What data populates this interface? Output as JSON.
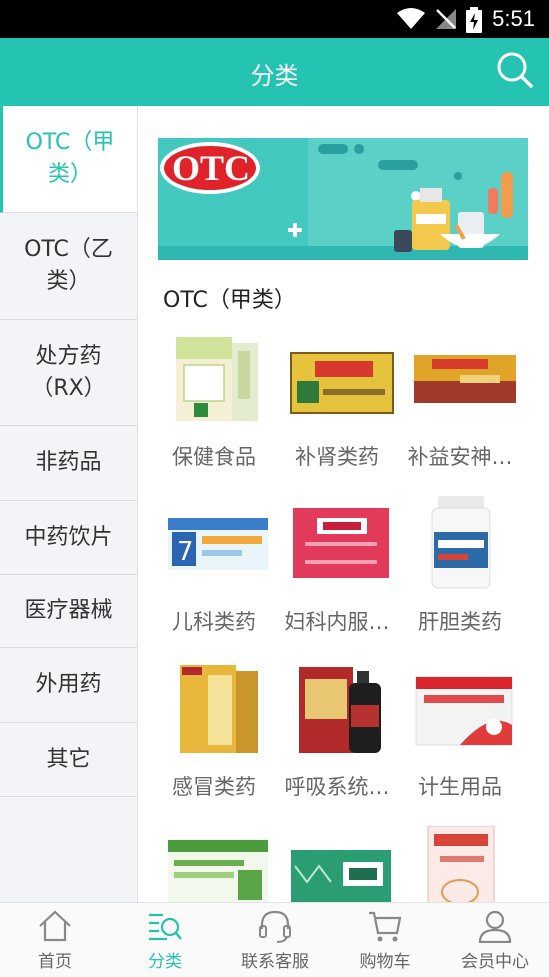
{
  "status_bar": {
    "time": "5:51"
  },
  "header": {
    "title": "分类"
  },
  "sidebar": {
    "items": [
      {
        "label": "OTC（甲类）",
        "active": true
      },
      {
        "label": "OTC（乙类）",
        "active": false
      },
      {
        "label": "处方药（RX）",
        "active": false
      },
      {
        "label": "非药品",
        "active": false
      },
      {
        "label": "中药饮片",
        "active": false
      },
      {
        "label": "医疗器械",
        "active": false
      },
      {
        "label": "外用药",
        "active": false
      },
      {
        "label": "其它",
        "active": false
      }
    ]
  },
  "banner": {
    "badge_text": "OTC"
  },
  "section": {
    "title": "OTC（甲类）"
  },
  "grid": [
    {
      "label": "保健食品"
    },
    {
      "label": "补肾类药"
    },
    {
      "label": "补益安神…"
    },
    {
      "label": "儿科类药"
    },
    {
      "label": "妇科内服…"
    },
    {
      "label": "肝胆类药"
    },
    {
      "label": "感冒类药"
    },
    {
      "label": "呼吸系统…"
    },
    {
      "label": "计生用品"
    },
    {
      "label": ""
    },
    {
      "label": ""
    },
    {
      "label": ""
    }
  ],
  "bottom_nav": [
    {
      "label": "首页",
      "icon": "home-icon",
      "active": false
    },
    {
      "label": "分类",
      "icon": "category-icon",
      "active": true
    },
    {
      "label": "联系客服",
      "icon": "headset-icon",
      "active": false
    },
    {
      "label": "购物车",
      "icon": "cart-icon",
      "active": false
    },
    {
      "label": "会员中心",
      "icon": "user-icon",
      "active": false
    }
  ],
  "colors": {
    "accent": "#25c3b1",
    "sidebar_bg": "#f3f4f7"
  }
}
